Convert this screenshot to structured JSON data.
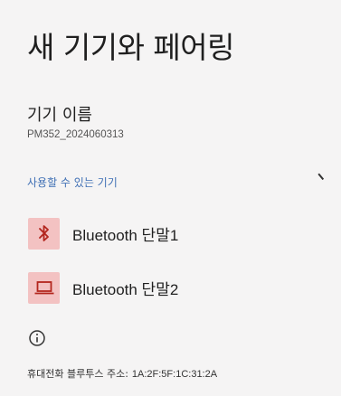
{
  "header": {
    "title": "새 기기와 페어링"
  },
  "device_name": {
    "label": "기기 이름",
    "value": "PM352_2024060313"
  },
  "available_devices": {
    "header": "사용할 수 있는 기기",
    "items": [
      {
        "label": "Bluetooth 단말1",
        "icon": "bluetooth-icon"
      },
      {
        "label": "Bluetooth 단말2",
        "icon": "laptop-icon"
      }
    ]
  },
  "footer": {
    "info_icon": "info-icon",
    "address_label": "휴대전화 블루투스 주소:",
    "address_value": "1A:2F:5F:1C:31:2A"
  },
  "colors": {
    "background": "#f5f4f4",
    "icon_background": "#f3c2c2",
    "icon_foreground": "#b3261e",
    "section_header": "#3f6fb4"
  }
}
